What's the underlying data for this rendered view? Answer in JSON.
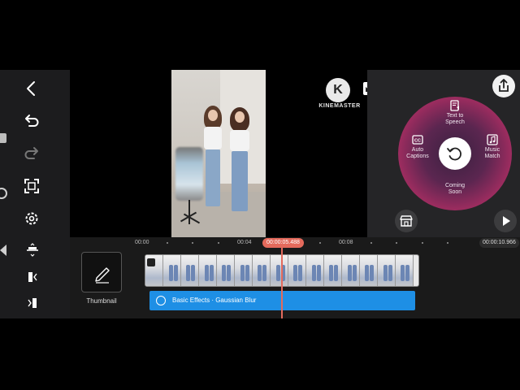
{
  "app": {
    "logo_letter": "K",
    "logo_text": "KINEMASTER"
  },
  "left_toolbar": {
    "icons": [
      "back-chevron-icon",
      "undo-icon",
      "redo-icon",
      "fullscreen-icon",
      "settings-icon"
    ]
  },
  "timeline_tools": {
    "icons": [
      "layer-align-icon",
      "trim-left-icon",
      "trim-right-icon"
    ]
  },
  "right_panel": {
    "wheel_items": {
      "text_to_speech": "Text to\nSpeech",
      "auto_captions": "Auto\nCaptions",
      "music_match": "Music\nMatch",
      "coming_soon": "Coming\nSoon"
    }
  },
  "timeline": {
    "ruler_labels": [
      "00:00",
      "00:04",
      "00:08"
    ],
    "current_time": "00:00:05.488",
    "total_time": "00:00:10.966",
    "thumbnail_label": "Thumbnail",
    "effect_label": "Basic Effects · Gaussian Blur"
  },
  "colors": {
    "accent_playhead": "#e46a5c",
    "effect_track": "#1e8fe5"
  }
}
